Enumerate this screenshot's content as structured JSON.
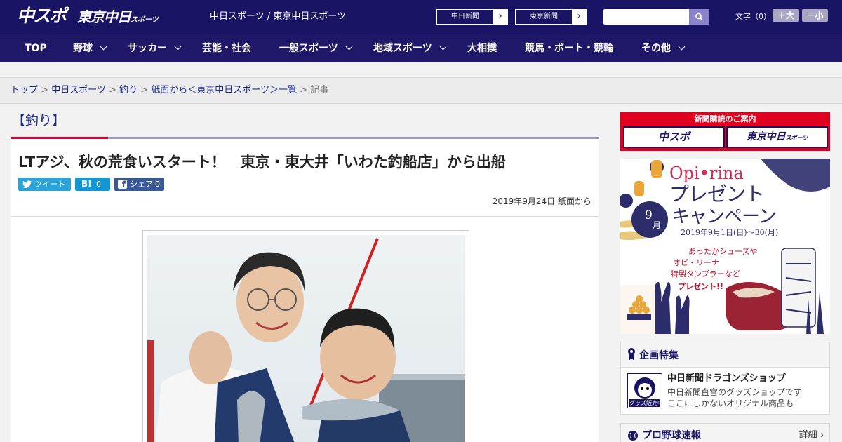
{
  "header": {
    "logo_chuspo": "中スポ",
    "logo_tokyo": "東京中日",
    "logo_tokyo_small": "スポーツ",
    "site_names": "中日スポーツ / 東京中日スポーツ",
    "btn_chunichi": "中日新聞",
    "btn_tokyo": "東京新聞",
    "arrow": "›",
    "search_icon": "search-icon",
    "font_label": "文字（0）",
    "font_plus": "＋大",
    "font_minus": "－小"
  },
  "nav": {
    "items": [
      "TOP",
      "野球",
      "サッカー",
      "芸能・社会",
      "一般スポーツ",
      "地域スポーツ",
      "大相撲",
      "競馬・ボート・競輪",
      "その他"
    ]
  },
  "breadcrumb": {
    "items": [
      "トップ",
      "中日スポーツ",
      "釣り",
      "紙面から＜東京中日スポーツ＞一覧",
      "記事"
    ],
    "sep": " > "
  },
  "article": {
    "category": "【釣り】",
    "title": "LTアジ、秋の荒食いスタート！　東京・東大井「いわた釣船店」から出船",
    "share": {
      "tweet": "ツイート",
      "hatena": "B!",
      "hatena_count": "0",
      "facebook": "シェア",
      "facebook_count": "0"
    },
    "date": "2019年9月24日 紙面から"
  },
  "sidebar": {
    "subscribe_title": "新聞購読のご案内",
    "subscribe_a": "中スポ",
    "subscribe_b": "東京中日",
    "subscribe_b_small": "スポーツ",
    "ad": {
      "brand": "Opi•rina",
      "title1": "プレゼント",
      "title2": "キャンペーン",
      "date": "2019年9月1日(日)〜30(月)",
      "month": "9",
      "month_unit": "月",
      "copy1": "あったかシューズや",
      "copy2": "オピ・リーナ",
      "copy3": "特製タンブラーなど",
      "copy4": "プレゼント!!"
    },
    "feature": {
      "title": "企画特集",
      "name": "中日新聞ドラゴンズショップ",
      "desc1": "中日新聞直営のグッズショップです",
      "desc2": "ここにしかないオリジナル商品も",
      "thumb_label": "グッズ販売中"
    },
    "pro": {
      "title": "プロ野球速報",
      "more": "詳細 ›"
    }
  },
  "colors": {
    "header_bg": "#1a1464",
    "accent_red": "#e6002d",
    "link": "#1e2a8c"
  }
}
